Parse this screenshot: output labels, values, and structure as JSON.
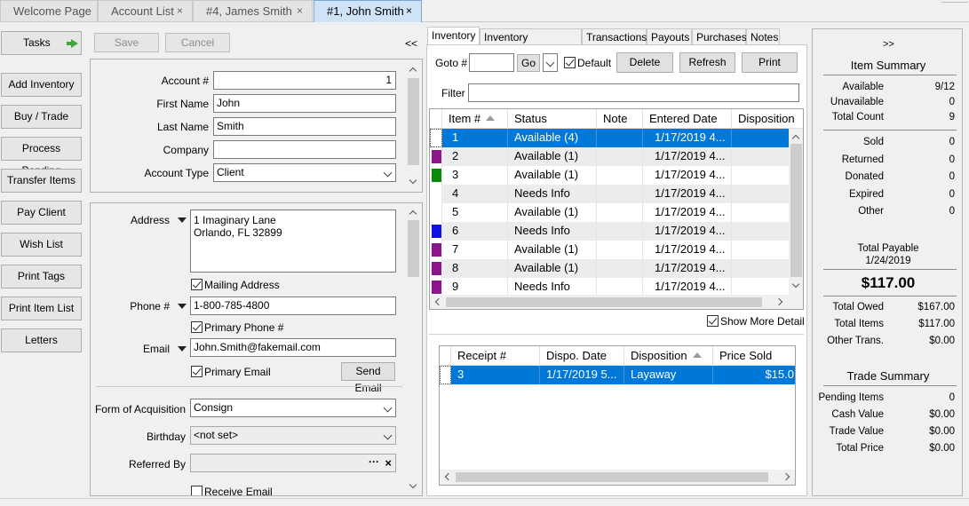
{
  "top_tabs": [
    {
      "label": "Welcome Page",
      "closable": false,
      "active": false
    },
    {
      "label": "Account List",
      "closable": true,
      "active": false
    },
    {
      "label": "#4, James Smith",
      "closable": true,
      "active": false
    },
    {
      "label": "#1, John Smith",
      "closable": true,
      "active": true
    }
  ],
  "close_glyph": "×",
  "left_nav": {
    "tasks": "Tasks",
    "items": [
      "Add Inventory",
      "Buy / Trade",
      "Process Pending",
      "Transfer Items",
      "Pay Client",
      "Wish List",
      "Print Tags",
      "Print Item List",
      "Letters"
    ]
  },
  "toolbar": {
    "save": "Save",
    "cancel": "Cancel",
    "collapse": "<<"
  },
  "account": {
    "account_no_label": "Account #",
    "account_no": "1",
    "first_name_label": "First Name",
    "first_name": "John",
    "last_name_label": "Last Name",
    "last_name": "Smith",
    "company_label": "Company",
    "company": "",
    "account_type_label": "Account Type",
    "account_type": "Client"
  },
  "contact": {
    "address_label": "Address",
    "address_line1": "1 Imaginary Lane",
    "address_line2": "Orlando, FL  32899",
    "mailing_address": "Mailing Address",
    "phone_label": "Phone #",
    "phone": "1-800-785-4800",
    "primary_phone": "Primary Phone #",
    "email_label": "Email",
    "email": "John.Smith@fakemail.com",
    "primary_email": "Primary Email",
    "send_email": "Send Email",
    "acquisition_label": "Form of Acquisition",
    "acquisition": "Consign",
    "birthday_label": "Birthday",
    "birthday": "<not set>",
    "referred_label": "Referred By",
    "referred_dots": "···",
    "referred_clear": "×",
    "receive_email": "Receive Email"
  },
  "inner_tabs": [
    "Inventory",
    "Inventory Disposition",
    "Transactions",
    "Payouts",
    "Purchases",
    "Notes"
  ],
  "inventory_toolbar": {
    "goto_label": "Goto #",
    "go": "Go",
    "default": "Default",
    "delete": "Delete",
    "refresh": "Refresh",
    "print": "Print",
    "filter_label": "Filter"
  },
  "inventory_grid": {
    "columns": [
      "Item #",
      "Status",
      "Note",
      "Entered Date",
      "Disposition"
    ],
    "rows": [
      {
        "item": "1",
        "status": "Available (4)",
        "note": "",
        "date": "1/17/2019 4...",
        "swatch": "",
        "selected": true
      },
      {
        "item": "2",
        "status": "Available (1)",
        "note": "",
        "date": "1/17/2019 4...",
        "swatch": "#8b168b",
        "selected": false
      },
      {
        "item": "3",
        "status": "Available (1)",
        "note": "",
        "date": "1/17/2019 4...",
        "swatch": "#0a8a0a",
        "selected": false
      },
      {
        "item": "4",
        "status": "Needs Info",
        "note": "",
        "date": "1/17/2019 4...",
        "swatch": "",
        "selected": false
      },
      {
        "item": "5",
        "status": "Available (1)",
        "note": "",
        "date": "1/17/2019 4...",
        "swatch": "",
        "selected": false
      },
      {
        "item": "6",
        "status": "Needs Info",
        "note": "",
        "date": "1/17/2019 4...",
        "swatch": "#1010e0",
        "selected": false
      },
      {
        "item": "7",
        "status": "Available (1)",
        "note": "",
        "date": "1/17/2019 4...",
        "swatch": "#8b168b",
        "selected": false
      },
      {
        "item": "8",
        "status": "Available (1)",
        "note": "",
        "date": "1/17/2019 4...",
        "swatch": "#8b168b",
        "selected": false
      },
      {
        "item": "9",
        "status": "Needs Info",
        "note": "",
        "date": "1/17/2019 4...",
        "swatch": "#8b168b",
        "selected": false
      }
    ]
  },
  "show_more_detail": "Show More Detail",
  "receipt_grid": {
    "columns": [
      "Receipt #",
      "Dispo. Date",
      "Disposition",
      "Price Sold"
    ],
    "rows": [
      {
        "receipt": "3",
        "date": "1/17/2019 5...",
        "disposition": "Layaway",
        "price": "$15.0"
      }
    ]
  },
  "summary": {
    "expand": ">>",
    "item_summary_title": "Item Summary",
    "group1": [
      {
        "k": "Available",
        "v": "9/12"
      },
      {
        "k": "Unavailable",
        "v": "0"
      },
      {
        "k": "Total Count",
        "v": "9"
      }
    ],
    "group2": [
      {
        "k": "Sold",
        "v": "0"
      },
      {
        "k": "Returned",
        "v": "0"
      },
      {
        "k": "Donated",
        "v": "0"
      },
      {
        "k": "Expired",
        "v": "0"
      },
      {
        "k": "Other",
        "v": "0"
      }
    ],
    "total_payable_label": "Total Payable",
    "total_payable_date": "1/24/2019",
    "total_payable_amount": "$117.00",
    "group3": [
      {
        "k": "Total Owed",
        "v": "$167.00"
      },
      {
        "k": "Total Items",
        "v": "$117.00"
      },
      {
        "k": "Other Trans.",
        "v": "$0.00"
      }
    ],
    "trade_summary_title": "Trade Summary",
    "group4": [
      {
        "k": "Pending Items",
        "v": "0"
      },
      {
        "k": "Cash Value",
        "v": "$0.00"
      },
      {
        "k": "Trade Value",
        "v": "$0.00"
      },
      {
        "k": "Total Price",
        "v": "$0.00"
      }
    ]
  }
}
